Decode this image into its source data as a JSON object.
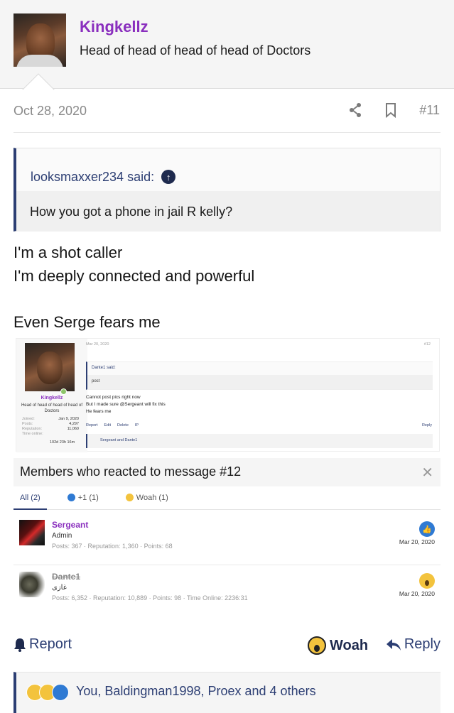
{
  "post": {
    "author": "Kingkellz",
    "author_title": "Head of head of head of head of Doctors",
    "date": "Oct 28, 2020",
    "number": "#11",
    "quote_author": "looksmaxxer234 said:",
    "quote_text": "How you got a phone in jail R kelly?",
    "lines": [
      "I'm a shot caller",
      "I'm deeply connected and powerful",
      "Even Serge fears me"
    ]
  },
  "embed": {
    "author": "Kingkellz",
    "author_title": "Head of head of head of head of Doctors",
    "stats": [
      {
        "k": "Joined:",
        "v": "Jan 9, 2020"
      },
      {
        "k": "Posts:",
        "v": "4,297"
      },
      {
        "k": "Reputation:",
        "v": "11,060"
      },
      {
        "k": "Time online:",
        "v": ""
      }
    ],
    "time_online": "102d 23h 16m",
    "date": "Mar 20, 2020",
    "number": "#12",
    "quote_author": "Dante1 said:",
    "quote_text": "post",
    "lines": [
      "Cannot post pics right now",
      "But I made sure @Sergeant will fix this",
      "He fears me"
    ],
    "actions": [
      "Report",
      "Edit",
      "Delete",
      "IP"
    ],
    "reply": "Reply",
    "reactions": "Sergeant and Dante1"
  },
  "reactions_panel": {
    "title": "Members who reacted to message #12",
    "tabs": [
      "All (2)",
      "+1 (1)",
      "Woah (1)"
    ],
    "members": [
      {
        "name": "Sergeant",
        "role": "Admin",
        "stats": "Posts: 367 · Reputation: 1,360 · Points: 68",
        "date": "Mar 20, 2020",
        "reaction": "like-icon",
        "name_color": "#8a2fbe"
      },
      {
        "name": "Dante1",
        "role": "غازى",
        "stats": "Posts: 6,352 · Reputation: 10,889 · Points: 98 · Time Online: 2236:31",
        "date": "Mar 20, 2020",
        "reaction": "woah-icon",
        "name_color": "#888888"
      }
    ]
  },
  "footer": {
    "report": "Report",
    "woah": "Woah",
    "reply": "Reply"
  },
  "reactions_summary": "You, Baldingman1998, Proex and 4 others",
  "colors": {
    "accent": "#2c3e73",
    "username": "#8a2fbe",
    "like": "#2f7ad3",
    "woah": "#f3c33d"
  }
}
